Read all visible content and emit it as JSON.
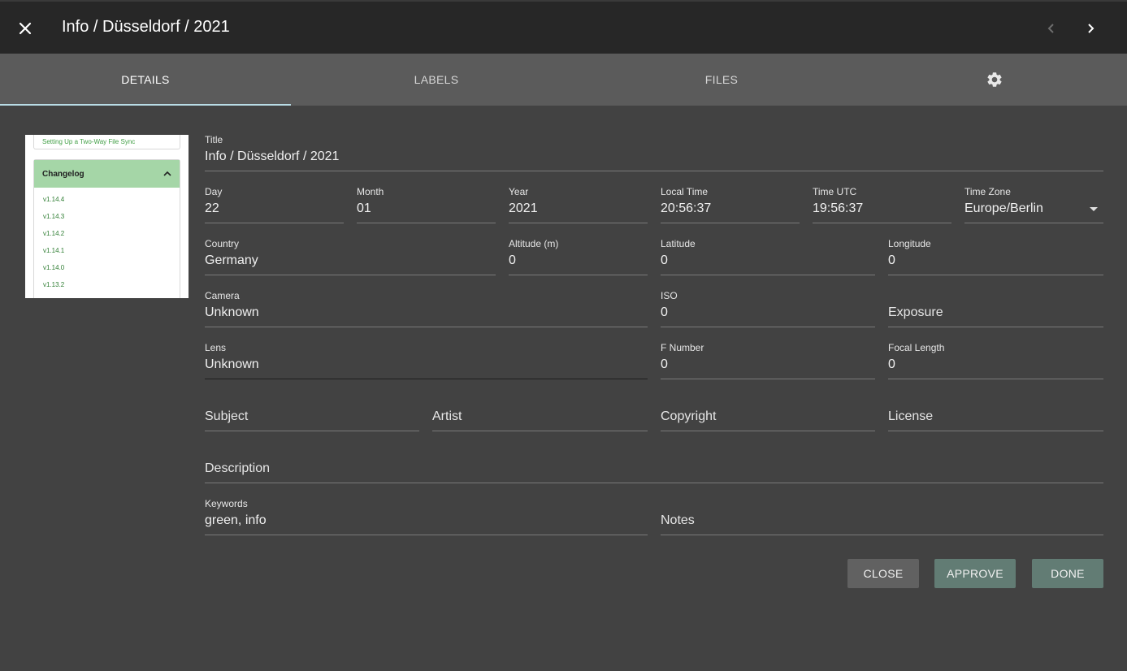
{
  "header": {
    "title": "Info / Düsseldorf / 2021",
    "close_icon": "close-icon",
    "prev_icon": "chevron-left-icon",
    "next_icon": "chevron-right-icon"
  },
  "tabs": [
    {
      "label": "DETAILS",
      "active": true
    },
    {
      "label": "LABELS",
      "active": false
    },
    {
      "label": "FILES",
      "active": false
    },
    {
      "label": "",
      "icon": "gear-icon",
      "active": false
    }
  ],
  "thumbnail": {
    "prev_link": "Setting Up a Two-Way File Sync",
    "section_title": "Changelog",
    "items": [
      "v1.14.4",
      "v1.14.3",
      "v1.14.2",
      "v1.14.1",
      "v1.14.0",
      "v1.13.2"
    ]
  },
  "form": {
    "title": {
      "label": "Title",
      "value": "Info / Düsseldorf / 2021"
    },
    "day": {
      "label": "Day",
      "value": "22"
    },
    "month": {
      "label": "Month",
      "value": "01"
    },
    "year": {
      "label": "Year",
      "value": "2021"
    },
    "local_time": {
      "label": "Local Time",
      "value": "20:56:37"
    },
    "time_utc": {
      "label": "Time UTC",
      "value": "19:56:37"
    },
    "time_zone": {
      "label": "Time Zone",
      "value": "Europe/Berlin"
    },
    "country": {
      "label": "Country",
      "value": "Germany"
    },
    "altitude": {
      "label": "Altitude (m)",
      "value": "0"
    },
    "latitude": {
      "label": "Latitude",
      "value": "0"
    },
    "longitude": {
      "label": "Longitude",
      "value": "0"
    },
    "camera": {
      "label": "Camera",
      "value": "Unknown"
    },
    "iso": {
      "label": "ISO",
      "value": "0"
    },
    "exposure": {
      "placeholder": "Exposure"
    },
    "lens": {
      "label": "Lens",
      "value": "Unknown"
    },
    "f_number": {
      "label": "F Number",
      "value": "0"
    },
    "focal_length": {
      "label": "Focal Length",
      "value": "0"
    },
    "subject": {
      "placeholder": "Subject"
    },
    "artist": {
      "placeholder": "Artist"
    },
    "copyright": {
      "placeholder": "Copyright"
    },
    "license": {
      "placeholder": "License"
    },
    "description": {
      "placeholder": "Description"
    },
    "keywords": {
      "label": "Keywords",
      "value": "green, info"
    },
    "notes": {
      "placeholder": "Notes"
    }
  },
  "actions": {
    "close": "CLOSE",
    "approve": "APPROVE",
    "done": "DONE"
  },
  "colors": {
    "background": "#424242",
    "toolbar": "#272727",
    "tabs_bar": "#5b5b5b",
    "tab_indicator": "#b9dce6",
    "close_button": "#616161",
    "primary_button": "#627c74"
  }
}
